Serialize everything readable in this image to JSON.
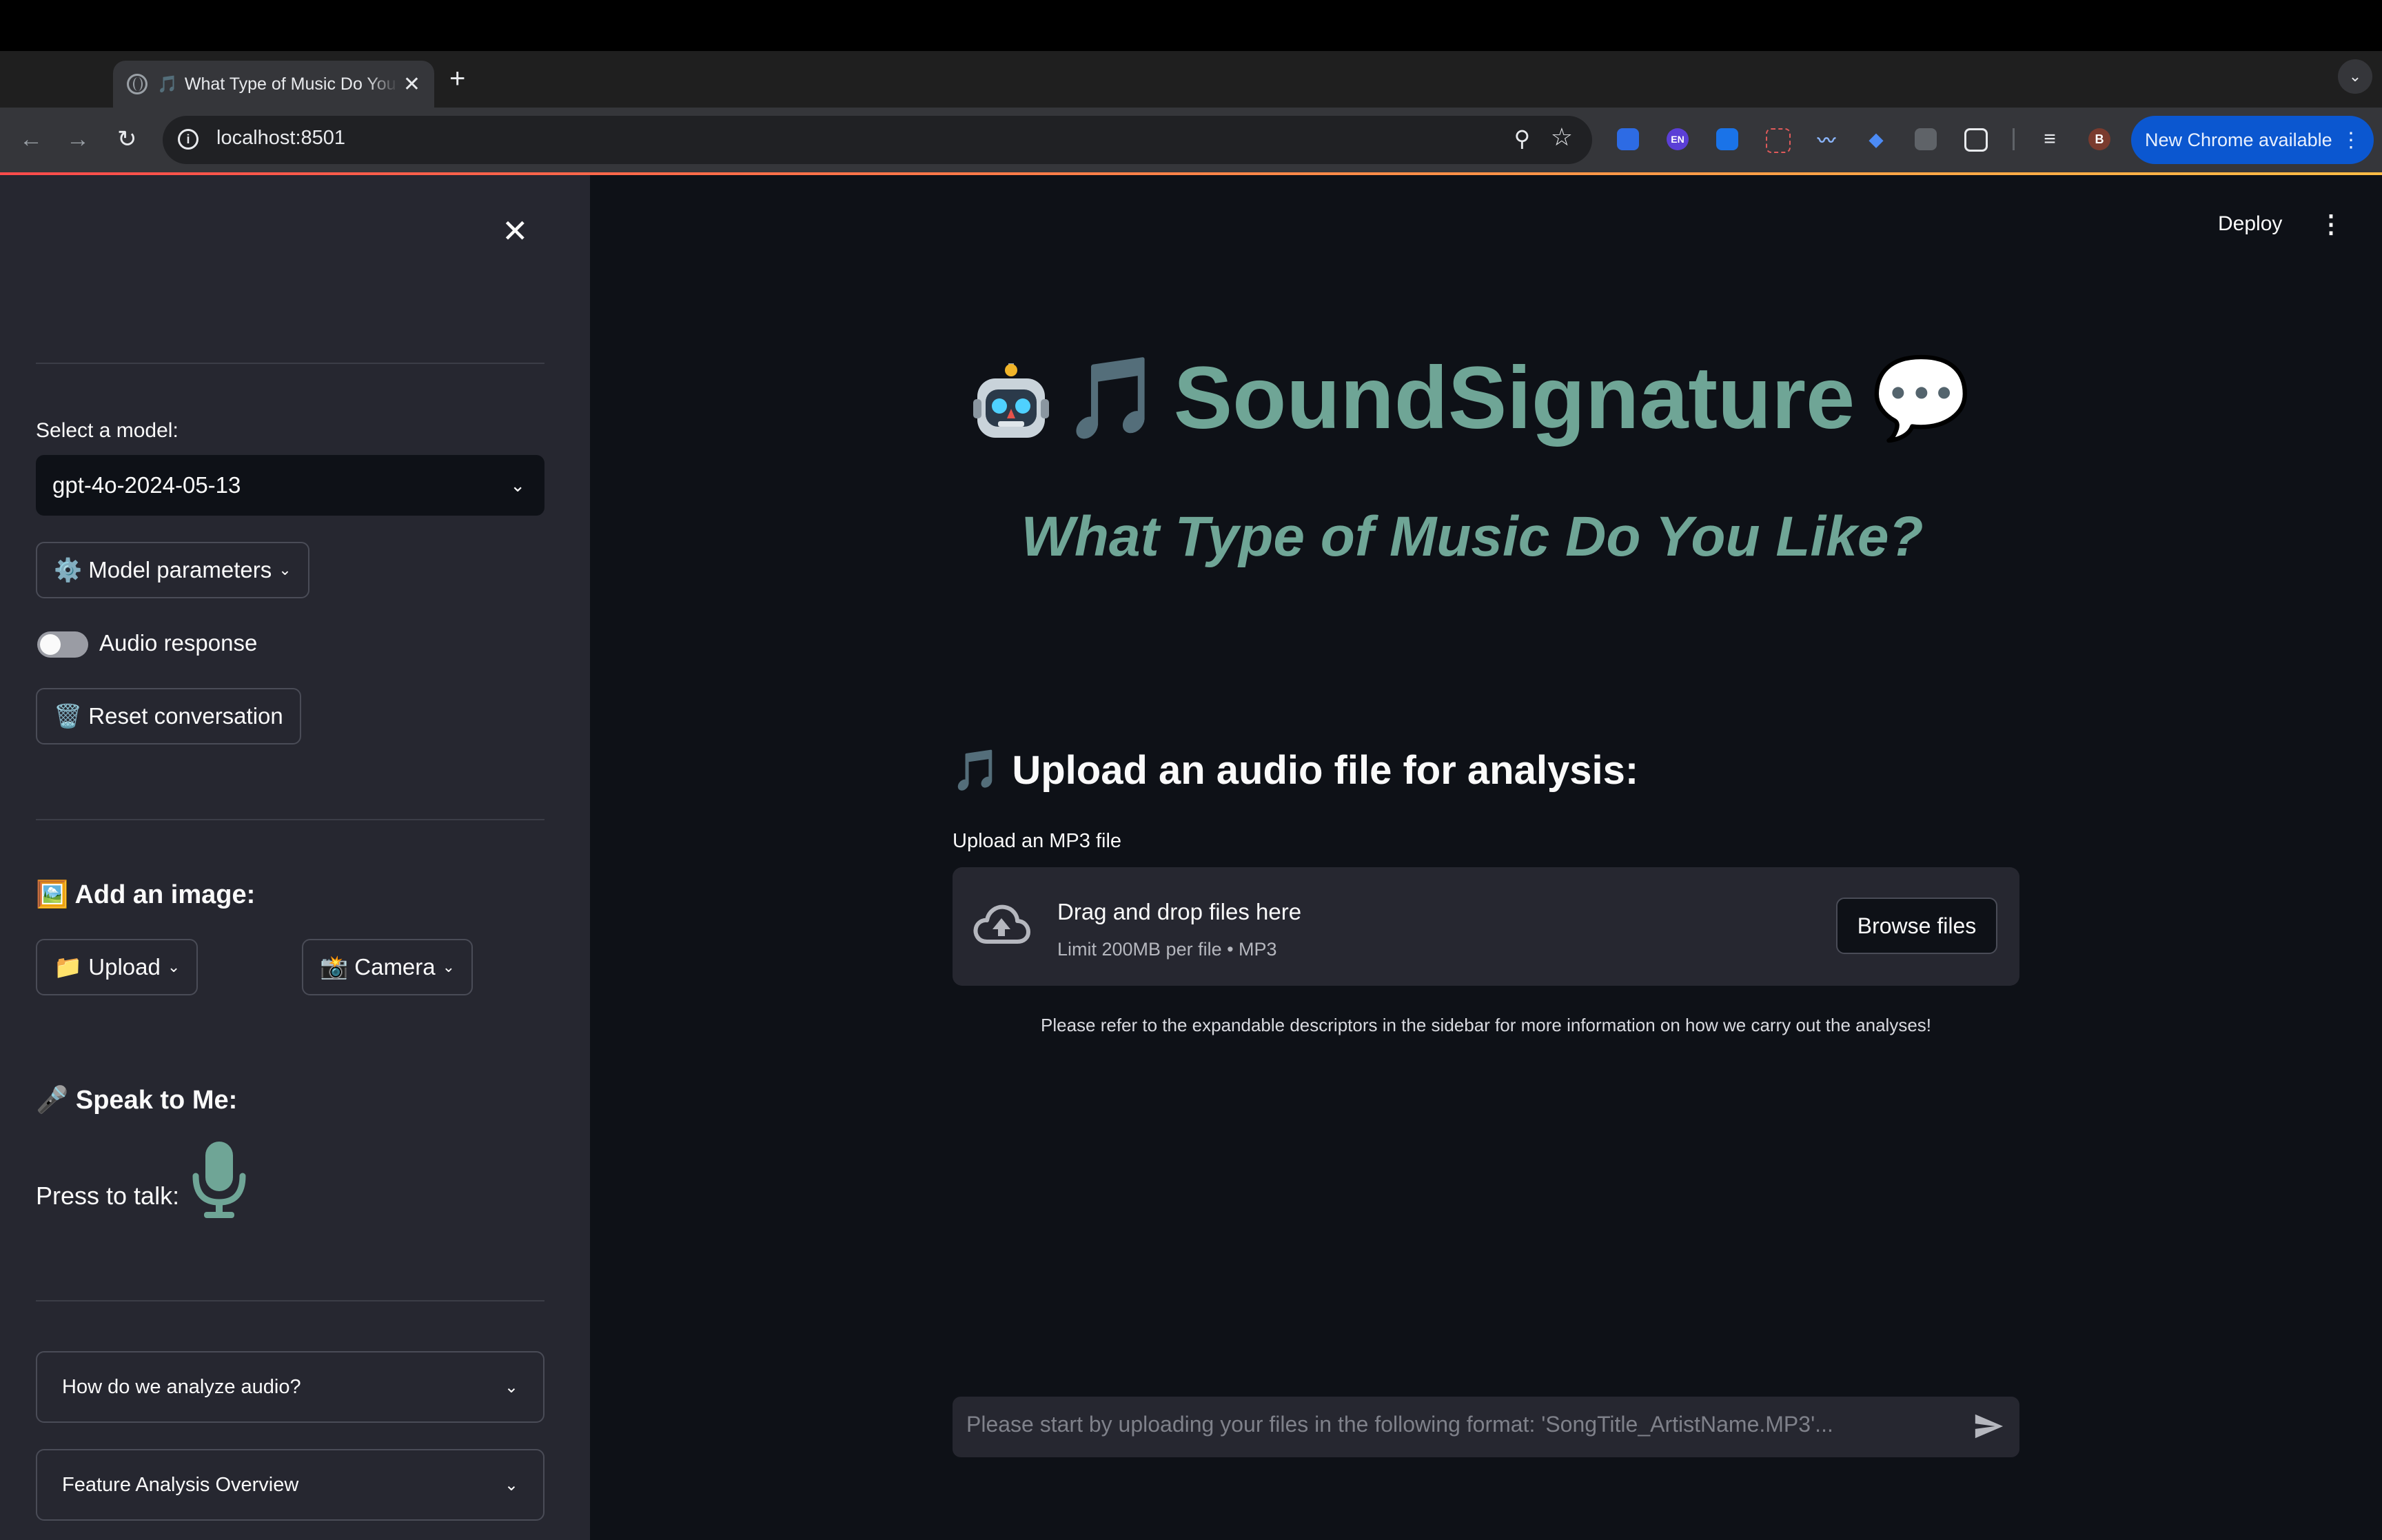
{
  "browser": {
    "tab_title": "What Type of Music Do You Like?",
    "tab_note": "🎵",
    "tab_close": "✕",
    "new_tab": "+",
    "tab_menu": "⌄",
    "back": "←",
    "forward": "→",
    "reload": "↻",
    "url": "localhost:8501",
    "info_glyph": "i",
    "zoom_icon": "⚲",
    "star_icon": "☆",
    "profile_initial": "B",
    "ext_en_label": "EN",
    "new_chrome_label": "New Chrome available",
    "new_chrome_menu": "⋮"
  },
  "sidebar": {
    "close_glyph": "✕",
    "model_label": "Select a model:",
    "model_value": "gpt-4o-2024-05-13",
    "model_params": "⚙️ Model parameters",
    "audio_response": "Audio response",
    "audio_response_on": false,
    "reset": "🗑️ Reset conversation",
    "add_image_heading": "🖼️ Add an image:",
    "upload": "📁 Upload",
    "camera": "📸 Camera",
    "speak_heading": "🎤 Speak to Me:",
    "press_to_talk": "Press to talk:",
    "expanders": [
      "How do we analyze audio?",
      "Feature Analysis Overview"
    ],
    "chevron": "⌄"
  },
  "main": {
    "deploy": "Deploy",
    "menu_glyph": "⋮",
    "title_prefix_emoji": "🎵",
    "title": "SoundSignature",
    "title_suffix_emoji": "💬",
    "subtitle": "What Type of Music Do You Like?",
    "upload_heading": "🎵 Upload an audio file for analysis:",
    "upload_label": "Upload an MP3 file",
    "drop_title": "Drag and drop files here",
    "drop_limit": "Limit 200MB per file • MP3",
    "browse": "Browse files",
    "caption": "Please refer to the expandable descriptors in the sidebar for more information on how we carry out the analyses!",
    "chat_placeholder": "Please start by uploading your files in the following format: 'SongTitle_ArtistName.MP3'..."
  },
  "colors": {
    "accent_teal": "#6fa596",
    "sidebar_bg": "#262730",
    "main_bg": "#0e1117",
    "chrome_blue": "#0b57d0"
  }
}
